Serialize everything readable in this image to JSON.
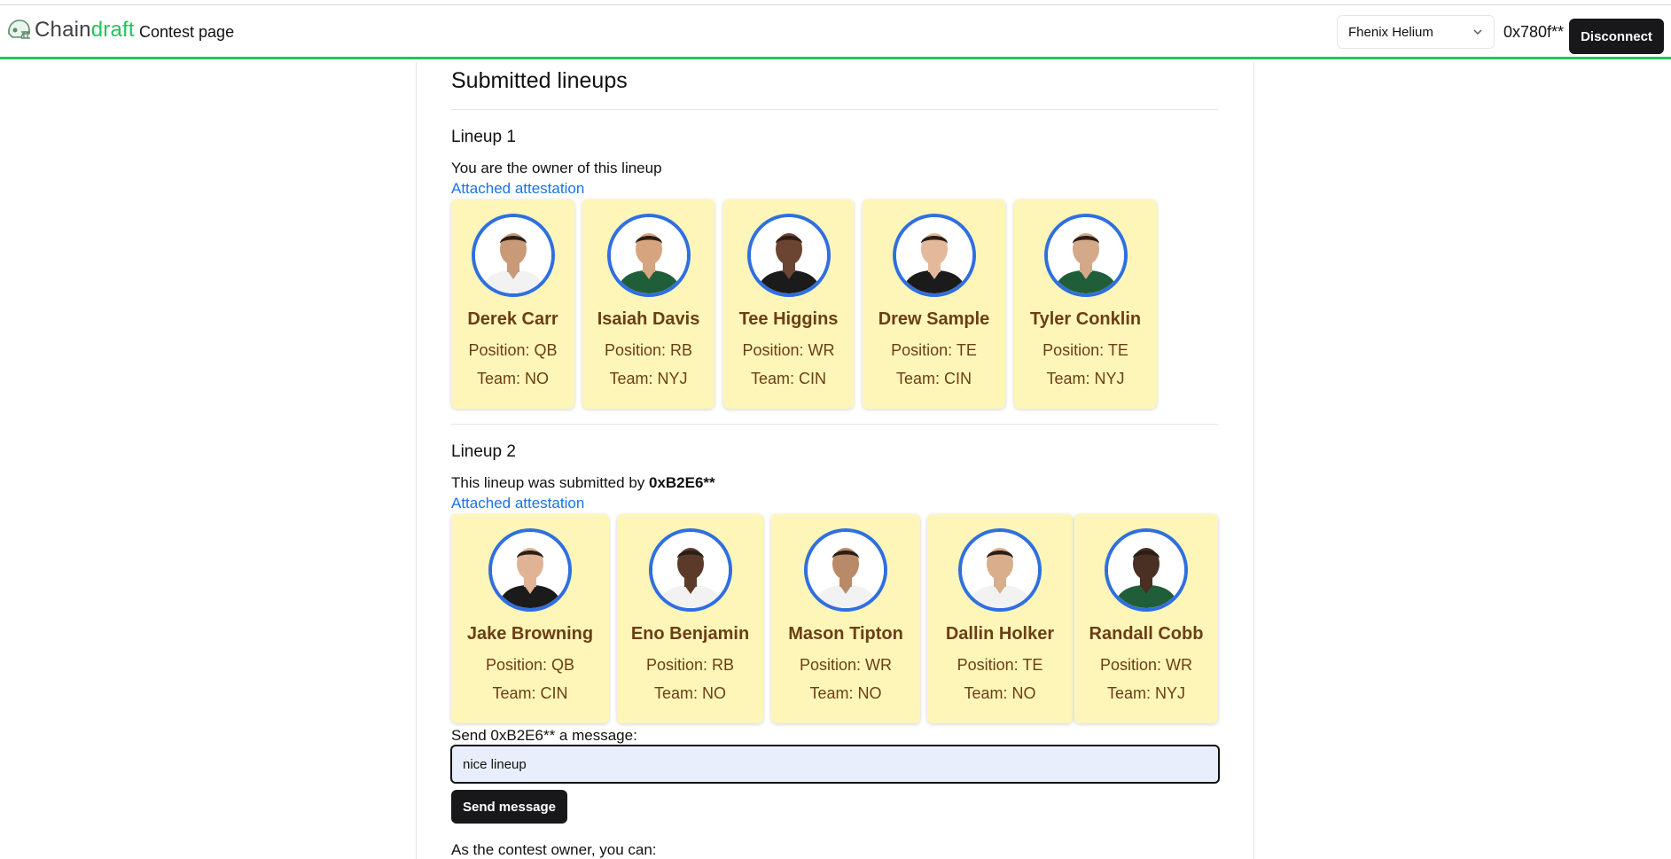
{
  "header": {
    "logo_chain": "Chain",
    "logo_draft": "draft",
    "page_link": "Contest page",
    "network": "Fhenix Helium",
    "address": "0x780f**",
    "disconnect_label": "Disconnect"
  },
  "colors": {
    "accent_green": "#22c55e",
    "card_bg": "#fef6b8",
    "avatar_ring": "#2f6fe0",
    "card_text": "#6b3e17",
    "link_blue": "#1a73e8"
  },
  "section_title": "Submitted lineups",
  "lineups": [
    {
      "title": "Lineup 1",
      "owner_text": "You are the owner of this lineup",
      "attestation": "Attached attestation",
      "players": [
        {
          "name": "Derek Carr",
          "position": "Position: QB",
          "team": "Team: NO",
          "jersey": "white"
        },
        {
          "name": "Isaiah Davis",
          "position": "Position: RB",
          "team": "Team: NYJ",
          "jersey": "green"
        },
        {
          "name": "Tee Higgins",
          "position": "Position: WR",
          "team": "Team: CIN",
          "jersey": "black"
        },
        {
          "name": "Drew Sample",
          "position": "Position: TE",
          "team": "Team: CIN",
          "jersey": "black"
        },
        {
          "name": "Tyler Conklin",
          "position": "Position: TE",
          "team": "Team: NYJ",
          "jersey": "green"
        }
      ]
    },
    {
      "title": "Lineup 2",
      "owner_prefix": "This lineup was submitted by ",
      "owner_address": "0xB2E6**",
      "attestation": "Attached attestation",
      "players": [
        {
          "name": "Jake Browning",
          "position": "Position: QB",
          "team": "Team: CIN",
          "jersey": "black"
        },
        {
          "name": "Eno Benjamin",
          "position": "Position: RB",
          "team": "Team: NO",
          "jersey": "white"
        },
        {
          "name": "Mason Tipton",
          "position": "Position: WR",
          "team": "Team: NO",
          "jersey": "white"
        },
        {
          "name": "Dallin Holker",
          "position": "Position: TE",
          "team": "Team: NO",
          "jersey": "white"
        },
        {
          "name": "Randall Cobb",
          "position": "Position: WR",
          "team": "Team: NYJ",
          "jersey": "green"
        }
      ]
    }
  ],
  "message": {
    "label": "Send 0xB2E6** a message:",
    "value": "nice lineup",
    "send_label": "Send message"
  },
  "owner_note": "As the contest owner, you can:"
}
